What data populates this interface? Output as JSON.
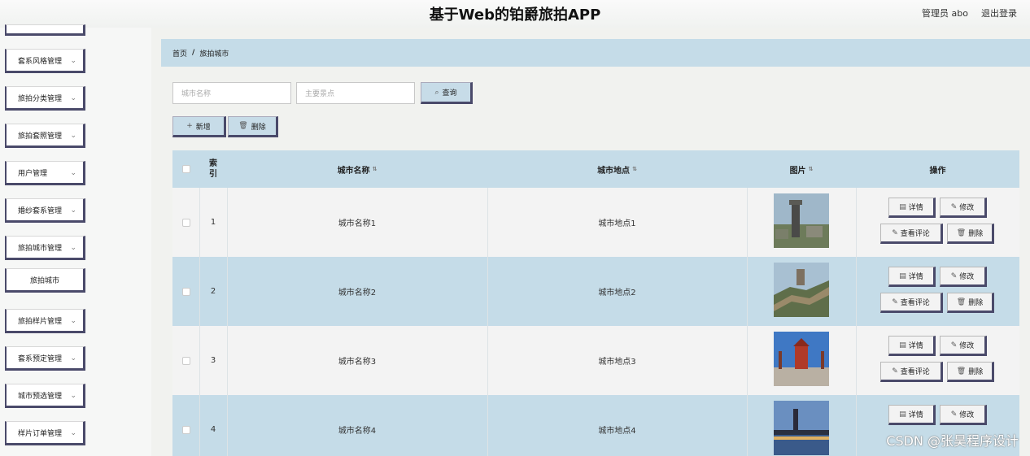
{
  "header": {
    "title": "基于Web的铂爵旅拍APP",
    "user_label": "管理员 abo",
    "logout_label": "退出登录"
  },
  "sidebar": {
    "items": [
      {
        "label": ""
      },
      {
        "label": "套系风格管理"
      },
      {
        "label": "旅拍分类管理"
      },
      {
        "label": "旅拍套照管理"
      },
      {
        "label": "用户管理"
      },
      {
        "label": "婚纱套系管理"
      },
      {
        "label": "旅拍城市管理"
      },
      {
        "label": "旅拍城市"
      },
      {
        "label": "旅拍样片管理"
      },
      {
        "label": "套系预定管理"
      },
      {
        "label": "城市预选管理"
      },
      {
        "label": "样片订单管理"
      }
    ]
  },
  "breadcrumb": {
    "home": "首页",
    "sep": "/",
    "current": "旅拍城市"
  },
  "search": {
    "city_placeholder": "城市名称",
    "spot_placeholder": "主要景点",
    "query_label": "查询"
  },
  "toolbar": {
    "add_label": "新增",
    "delete_label": "删除"
  },
  "table": {
    "headers": {
      "index": "索\n引",
      "city_name": "城市名称",
      "city_place": "城市地点",
      "image": "图片",
      "actions": "操作"
    },
    "rows": [
      {
        "index": "1",
        "city_name": "城市名称1",
        "city_place": "城市地点1"
      },
      {
        "index": "2",
        "city_name": "城市名称2",
        "city_place": "城市地点2"
      },
      {
        "index": "3",
        "city_name": "城市名称3",
        "city_place": "城市地点3"
      },
      {
        "index": "4",
        "city_name": "城市名称4",
        "city_place": "城市地点4"
      }
    ],
    "actions": {
      "detail": "详情",
      "edit": "修改",
      "comments": "查看评论",
      "delete": "删除"
    }
  },
  "watermark": "CSDN @张昊程序设计",
  "icons": {
    "search": "search-icon",
    "plus": "plus-icon",
    "trash": "trash-icon",
    "doc": "document-icon",
    "pen": "pen-icon",
    "chevron": "chevron-down-icon"
  },
  "colors": {
    "accent": "#c5dce8",
    "border_dark": "#4a4a6a"
  }
}
